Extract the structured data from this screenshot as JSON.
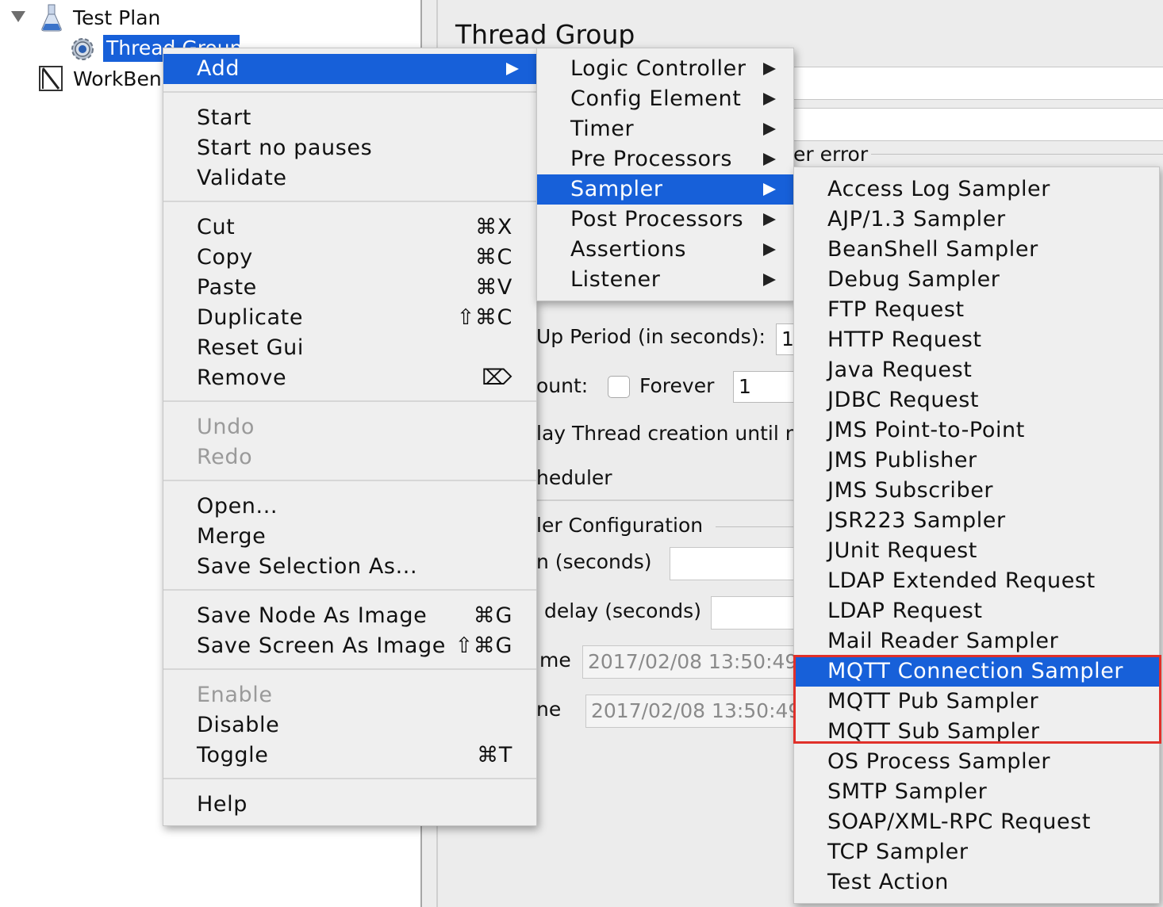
{
  "tree": {
    "test_plan": "Test Plan",
    "thread_group": "Thread Group",
    "workbench": "WorkBench"
  },
  "panel": {
    "title": "Thread Group",
    "sampler_error_frag": "er error",
    "rampup_label": "Up Period (in seconds):",
    "rampup_value": "1",
    "loop_label": "ount:",
    "forever_label": "Forever",
    "loop_value": "1",
    "delay_label": "lay Thread creation until n",
    "scheduler_label": "heduler",
    "scheduler_config": "ler Configuration",
    "duration_label": "n (seconds)",
    "startup_delay_label": "delay (seconds)",
    "start_time_label": "me",
    "start_time_value": "2017/02/08 13:50:49",
    "end_time_label": "ne",
    "end_time_value": "2017/02/08 13:50:49"
  },
  "context_menu": {
    "add": "Add",
    "start": "Start",
    "start_no_pauses": "Start no pauses",
    "validate": "Validate",
    "cut": "Cut",
    "cut_sc": "⌘X",
    "copy": "Copy",
    "copy_sc": "⌘C",
    "paste": "Paste",
    "paste_sc": "⌘V",
    "duplicate": "Duplicate",
    "duplicate_sc": "⇧⌘C",
    "reset_gui": "Reset Gui",
    "remove": "Remove",
    "remove_sc": "⌦",
    "undo": "Undo",
    "redo": "Redo",
    "open": "Open...",
    "merge": "Merge",
    "save_selection_as": "Save Selection As...",
    "save_node_as_image": "Save Node As Image",
    "save_node_sc": "⌘G",
    "save_screen_as_image": "Save Screen As Image",
    "save_screen_sc": "⇧⌘G",
    "enable": "Enable",
    "disable": "Disable",
    "toggle": "Toggle",
    "toggle_sc": "⌘T",
    "help": "Help"
  },
  "add_submenu": {
    "items": [
      "Logic Controller",
      "Config Element",
      "Timer",
      "Pre Processors",
      "Sampler",
      "Post Processors",
      "Assertions",
      "Listener"
    ]
  },
  "sampler_submenu": {
    "items": [
      "Access Log Sampler",
      "AJP/1.3 Sampler",
      "BeanShell Sampler",
      "Debug Sampler",
      "FTP Request",
      "HTTP Request",
      "Java Request",
      "JDBC Request",
      "JMS Point-to-Point",
      "JMS Publisher",
      "JMS Subscriber",
      "JSR223 Sampler",
      "JUnit Request",
      "LDAP Extended Request",
      "LDAP Request",
      "Mail Reader Sampler",
      "MQTT Connection Sampler",
      "MQTT Pub Sampler",
      "MQTT Sub Sampler",
      "OS Process Sampler",
      "SMTP Sampler",
      "SOAP/XML-RPC Request",
      "TCP Sampler",
      "Test Action"
    ]
  },
  "colors": {
    "selection": "#1760d9",
    "highlight_box": "#e0302a",
    "menu_bg": "#efefef",
    "panel_bg": "#ececec"
  }
}
